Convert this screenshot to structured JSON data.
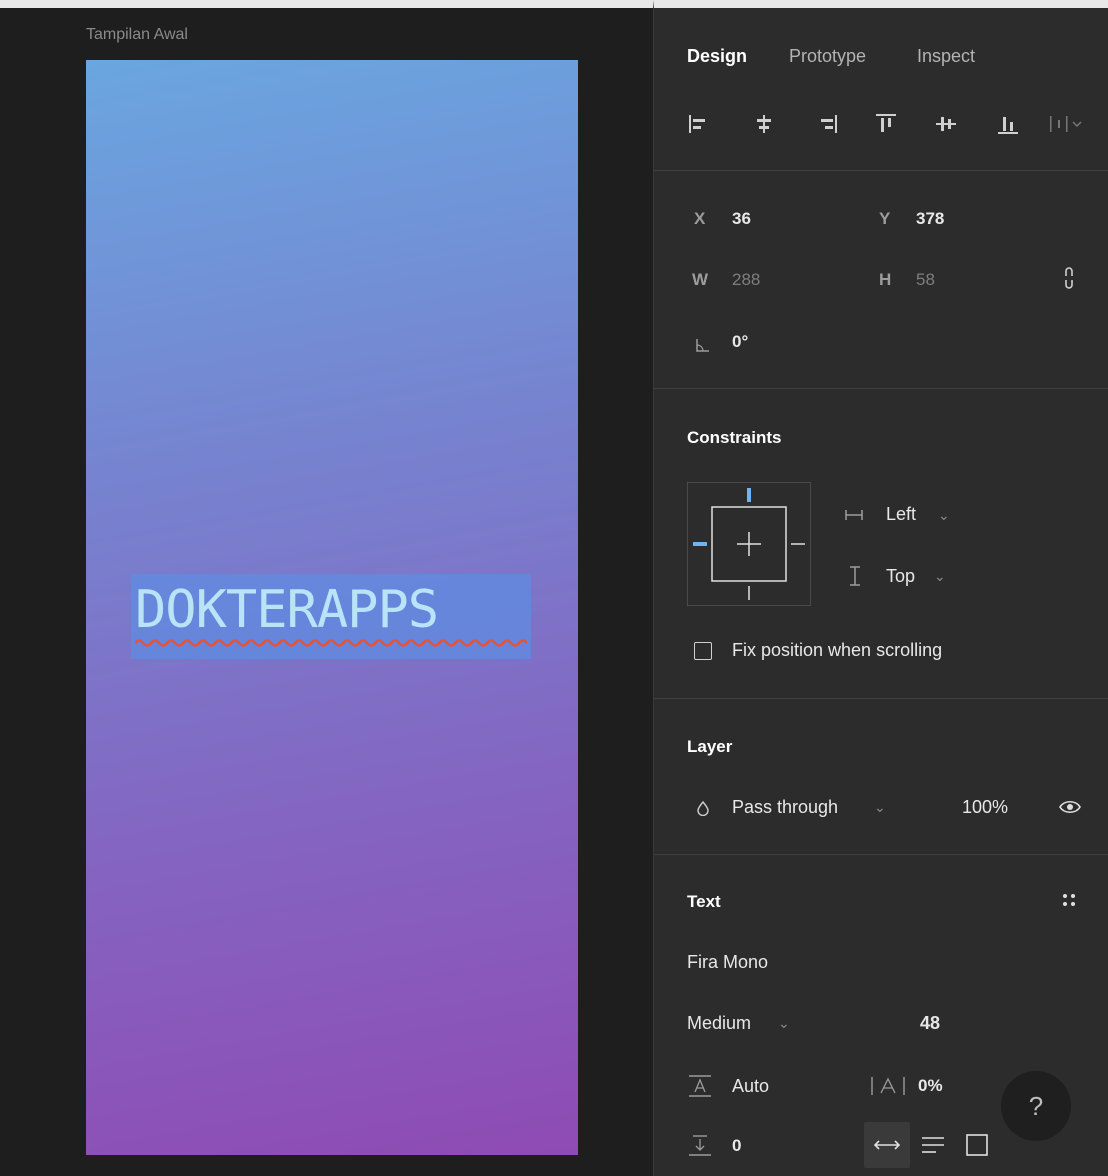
{
  "canvas": {
    "frame_label": "Tampilan Awal",
    "frame_text": "DOKTERAPPS",
    "colors": {
      "gradient_top": "#6aa6e0",
      "gradient_bottom": "#8e4bb3",
      "selection": "#5f8ce1"
    }
  },
  "tabs": [
    {
      "label": "Design",
      "active": true
    },
    {
      "label": "Prototype",
      "active": false
    },
    {
      "label": "Inspect",
      "active": false
    }
  ],
  "alignment_icons": [
    "align-left-icon",
    "align-horizontal-center-icon",
    "align-right-icon",
    "align-top-icon",
    "align-vertical-center-icon",
    "align-bottom-icon",
    "distribute-icon"
  ],
  "transform": {
    "x_label": "X",
    "x_value": "36",
    "y_label": "Y",
    "y_value": "378",
    "w_label": "W",
    "w_value": "288",
    "h_label": "H",
    "h_value": "58",
    "rotation_value": "0°"
  },
  "constraints": {
    "title": "Constraints",
    "horizontal": "Left",
    "vertical": "Top",
    "fix_position_label": "Fix position when scrolling"
  },
  "layer": {
    "title": "Layer",
    "blend_mode": "Pass through",
    "opacity": "100%"
  },
  "text": {
    "title": "Text",
    "font_family": "Fira Mono",
    "font_weight": "Medium",
    "font_size": "48",
    "line_height": "Auto",
    "letter_spacing": "0%",
    "paragraph_spacing": "0"
  },
  "help": {
    "label": "?"
  }
}
